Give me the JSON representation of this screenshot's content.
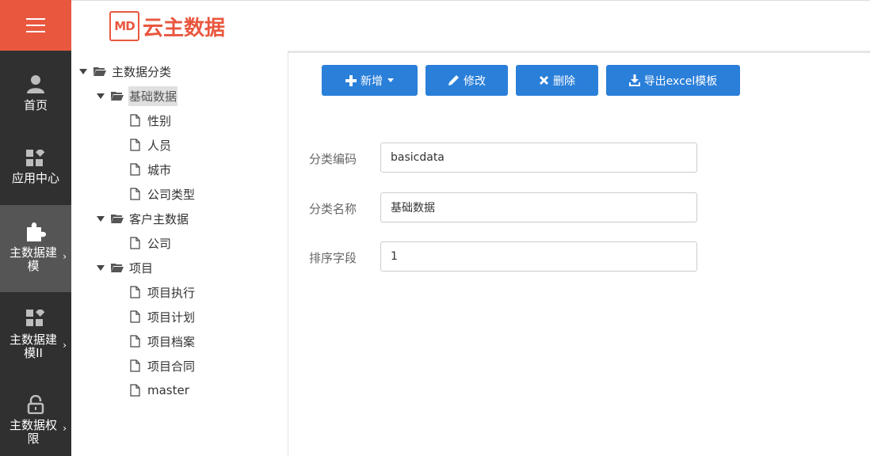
{
  "app": {
    "logo_mark": "MD",
    "logo_text": "云主数据"
  },
  "sidebar": {
    "items": [
      {
        "label": "首页",
        "icon": "user-icon"
      },
      {
        "label": "应用中心",
        "icon": "app-grid-icon"
      },
      {
        "label": "主数据建模",
        "icon": "puzzle-icon",
        "active": true
      },
      {
        "label": "主数据建模II",
        "icon": "app-grid-icon"
      },
      {
        "label": "主数据权限",
        "icon": "lock-icon"
      }
    ]
  },
  "tree": {
    "root": "主数据分类",
    "groups": [
      {
        "label": "基础数据",
        "children": [
          "性别",
          "人员",
          "城市",
          "公司类型"
        ]
      },
      {
        "label": "客户主数据",
        "children": [
          "公司"
        ]
      },
      {
        "label": "项目",
        "children": [
          "项目执行",
          "项目计划",
          "项目档案",
          "项目合同",
          "master"
        ]
      }
    ]
  },
  "toolbar": {
    "add_label": "新增",
    "edit_label": "修改",
    "delete_label": "删除",
    "export_label": "导出excel模板"
  },
  "form": {
    "code_label": "分类编码",
    "code_value": "basicdata",
    "name_label": "分类名称",
    "name_value": "基础数据",
    "sort_label": "排序字段",
    "sort_value": "1"
  },
  "colors": {
    "brand": "#e9573f",
    "primary": "#2a7fd9",
    "sidebar_bg": "#303030",
    "sidebar_active": "#555555"
  }
}
